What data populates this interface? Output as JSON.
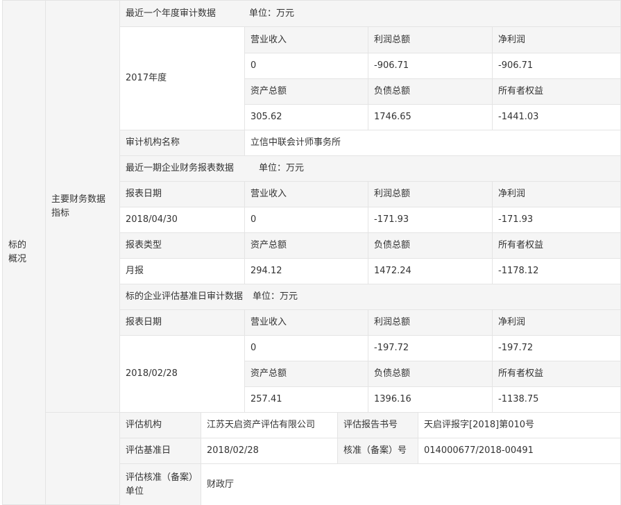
{
  "outer_label": "标的概况",
  "fin_label": "主要财务数据指标",
  "annual": {
    "title": "最近一个年度审计数据",
    "unit": "单位：万元",
    "year": "2017年度",
    "h1": [
      "营业收入",
      "利润总额",
      "净利润"
    ],
    "v1": [
      "0",
      "-906.71",
      "-906.71"
    ],
    "h2": [
      "资产总额",
      "负债总额",
      "所有者权益"
    ],
    "v2": [
      "305.62",
      "1746.65",
      "-1441.03"
    ],
    "auditor_label": "审计机构名称",
    "auditor_value": "立信中联会计师事务所"
  },
  "recent": {
    "title": "最近一期企业财务报表数据",
    "unit": "单位：万元",
    "h1": [
      "报表日期",
      "营业收入",
      "利润总额",
      "净利润"
    ],
    "v1": [
      "2018/04/30",
      "0",
      "-171.93",
      "-171.93"
    ],
    "h2": [
      "报表类型",
      "资产总额",
      "负债总额",
      "所有者权益"
    ],
    "v2": [
      "月报",
      "294.12",
      "1472.24",
      "-1178.12"
    ]
  },
  "eval": {
    "title": "标的企业评估基准日审计数据",
    "unit": "单位：万元",
    "h1": [
      "报表日期",
      "营业收入",
      "利润总额",
      "净利润"
    ],
    "date": "2018/02/28",
    "v1": [
      "0",
      "-197.72",
      "-197.72"
    ],
    "h2": [
      "资产总额",
      "负债总额",
      "所有者权益"
    ],
    "v2": [
      "257.41",
      "1396.16",
      "-1138.75"
    ]
  },
  "appraisal": {
    "org_label": "评估机构",
    "org_value": "江苏天启资产评估有限公司",
    "report_label": "评估报告书号",
    "report_value": "天启评报字[2018]第010号",
    "base_date_label": "评估基准日",
    "base_date_value": "2018/02/28",
    "approval_no_label": "核准（备案）号",
    "approval_no_value": "014000677/2018-00491",
    "approval_unit_label": "评估核准（备案）单位",
    "approval_unit_value": "财政厅"
  }
}
